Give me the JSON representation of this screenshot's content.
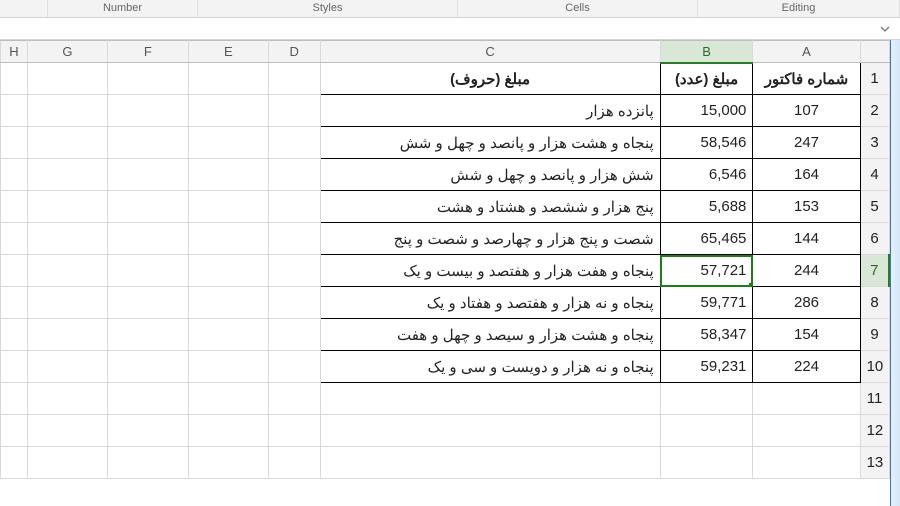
{
  "ribbon_groups": {
    "g1": "",
    "number": "Number",
    "styles": "Styles",
    "cells": "Cells",
    "editing": "Editing"
  },
  "columns": [
    "H",
    "G",
    "F",
    "E",
    "D",
    "C",
    "B",
    "A"
  ],
  "selected_column": "B",
  "selected_row": 7,
  "headers": {
    "A": "شماره فاکتور",
    "B": "مبلغ (عدد)",
    "C": "مبلغ (حروف)"
  },
  "rows": [
    {
      "n": 2,
      "A": "107",
      "B": "15,000",
      "C": "پانزده هزار"
    },
    {
      "n": 3,
      "A": "247",
      "B": "58,546",
      "C": "پنجاه و هشت هزار و پانصد و چهل و شش"
    },
    {
      "n": 4,
      "A": "164",
      "B": "6,546",
      "C": "شش هزار و پانصد و چهل و شش"
    },
    {
      "n": 5,
      "A": "153",
      "B": "5,688",
      "C": "پنج هزار و ششصد و هشتاد و هشت"
    },
    {
      "n": 6,
      "A": "144",
      "B": "65,465",
      "C": "شصت و پنج هزار و چهارصد و شصت و پنج"
    },
    {
      "n": 7,
      "A": "244",
      "B": "57,721",
      "C": "پنجاه و هفت هزار و هفتصد و بیست و یک"
    },
    {
      "n": 8,
      "A": "286",
      "B": "59,771",
      "C": "پنجاه و نه هزار و هفتصد و هفتاد و یک"
    },
    {
      "n": 9,
      "A": "154",
      "B": "58,347",
      "C": "پنجاه و هشت هزار و سیصد و چهل و هفت"
    },
    {
      "n": 10,
      "A": "224",
      "B": "59,231",
      "C": "پنجاه و نه هزار و دویست و سی و یک"
    }
  ],
  "empty_rows": [
    11,
    12,
    13
  ],
  "chart_data": null
}
